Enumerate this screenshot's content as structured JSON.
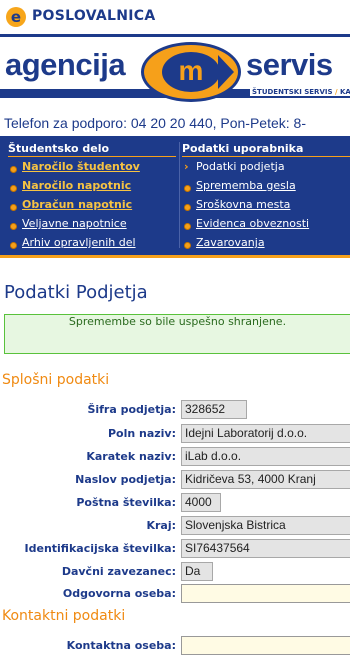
{
  "brand": {
    "logo_letter": "e",
    "name": "POSLOVALNICA"
  },
  "banner": {
    "word_left": "agencija",
    "emblem_letter": "m",
    "word_right": "servis",
    "tagline_a": "ŠTUDENTSKI SERVIS",
    "tagline_sep": "/",
    "tagline_b": "KADRO"
  },
  "phone": "Telefon za podporo: 04 20 20 440, Pon-Petek: 8-",
  "nav": {
    "left": {
      "heading": "Študentsko delo",
      "items": [
        {
          "label": "Naročilo študentov"
        },
        {
          "label": "Naročilo napotnic"
        },
        {
          "label": "Obračun napotnic"
        },
        {
          "label": "Veljavne napotnice"
        },
        {
          "label": "Arhiv opravljenih del"
        }
      ]
    },
    "right": {
      "heading": "Podatki uporabnika",
      "items": [
        {
          "label": "Podatki podjetja"
        },
        {
          "label": "Sprememba gesla"
        },
        {
          "label": "Sroškovna mesta"
        },
        {
          "label": "Evidenca obveznosti"
        },
        {
          "label": "Zavarovanja"
        }
      ]
    }
  },
  "page_title": "Podatki Podjetja",
  "success_message": "Spremembe so bile uspešno shranjene.",
  "sections": {
    "general": "Splošni podatki",
    "contact": "Kontaktni podatki"
  },
  "general_fields": [
    {
      "label": "Šifra podjetja:",
      "value": "328652"
    },
    {
      "label": "Poln naziv:",
      "value": "Idejni Laboratorij d.o.o."
    },
    {
      "label": "Karatek naziv:",
      "value": "iLab d.o.o."
    },
    {
      "label": "Naslov podjetja:",
      "value": "Kidričeva 53, 4000 Kranj"
    },
    {
      "label": "Poštna številka:",
      "value": "4000"
    },
    {
      "label": "Kraj:",
      "value": "Slovenjska Bistrica"
    },
    {
      "label": "Identifikacijska številka:",
      "value": "SI76437564"
    },
    {
      "label": "Davčni zavezanec:",
      "value": "Da"
    },
    {
      "label": "Odgovorna oseba:",
      "value": ""
    }
  ],
  "contact_fields": [
    {
      "label": "Kontaktna oseba:",
      "value": ""
    }
  ],
  "colors": {
    "brand_blue": "#1d3a8a",
    "accent_orange": "#f6a01a",
    "success_green": "#59c23b"
  }
}
